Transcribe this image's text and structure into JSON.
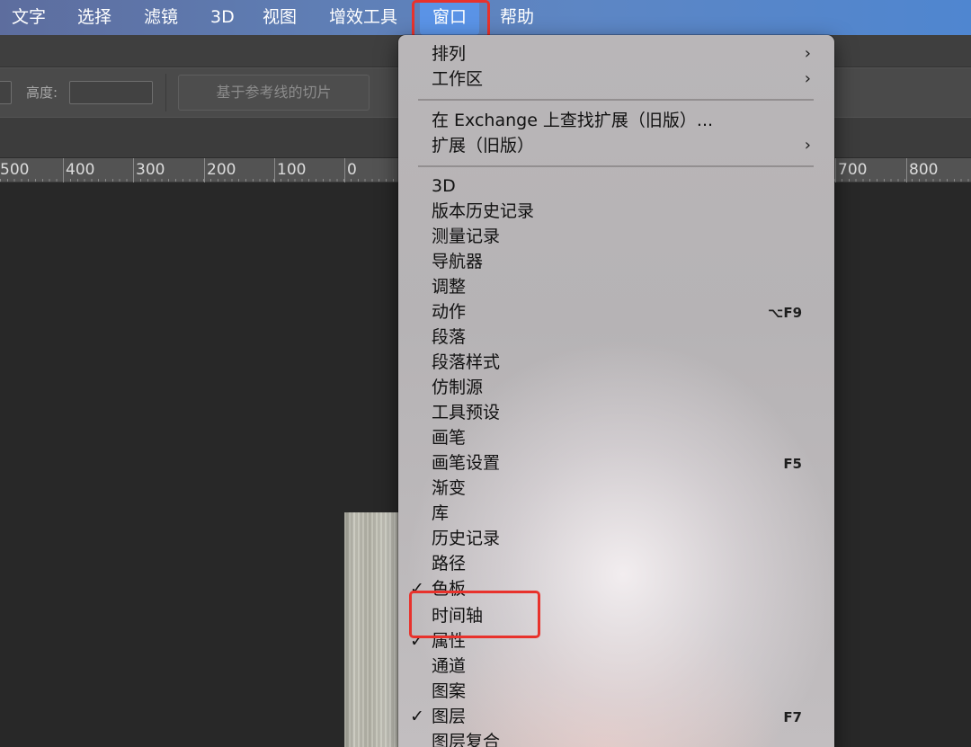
{
  "menubar": {
    "items": [
      "文字",
      "选择",
      "滤镜",
      "3D",
      "视图",
      "增效工具",
      "窗口",
      "帮助"
    ],
    "active": "窗口"
  },
  "options_bar": {
    "height_label": "高度:",
    "slice_button": "基于参考线的切片"
  },
  "ruler": {
    "labels": [
      "500",
      "400",
      "300",
      "200",
      "100",
      "0",
      "700",
      "800"
    ]
  },
  "window_menu": {
    "items": [
      {
        "label": "排列",
        "submenu": "›"
      },
      {
        "label": "工作区",
        "submenu": "›"
      },
      {
        "label": "在 Exchange 上查找扩展（旧版）..."
      },
      {
        "label": "扩展（旧版）",
        "submenu": "›"
      },
      {
        "label": "3D"
      },
      {
        "label": "版本历史记录"
      },
      {
        "label": "测量记录"
      },
      {
        "label": "导航器"
      },
      {
        "label": "调整"
      },
      {
        "label": "动作",
        "shortcut": "⌥F9"
      },
      {
        "label": "段落"
      },
      {
        "label": "段落样式"
      },
      {
        "label": "仿制源"
      },
      {
        "label": "工具预设"
      },
      {
        "label": "画笔"
      },
      {
        "label": "画笔设置",
        "shortcut": "F5"
      },
      {
        "label": "渐变"
      },
      {
        "label": "库"
      },
      {
        "label": "历史记录"
      },
      {
        "label": "路径"
      },
      {
        "label": "色板",
        "check": "✓"
      },
      {
        "label": "时间轴"
      },
      {
        "label": "属性",
        "check": "✓"
      },
      {
        "label": "通道"
      },
      {
        "label": "图案"
      },
      {
        "label": "图层",
        "check": "✓",
        "shortcut": "F7"
      },
      {
        "label": "图层复合"
      }
    ]
  },
  "colors": {
    "annotation": "#e8322c",
    "menubar_active": "#5a93e6"
  }
}
